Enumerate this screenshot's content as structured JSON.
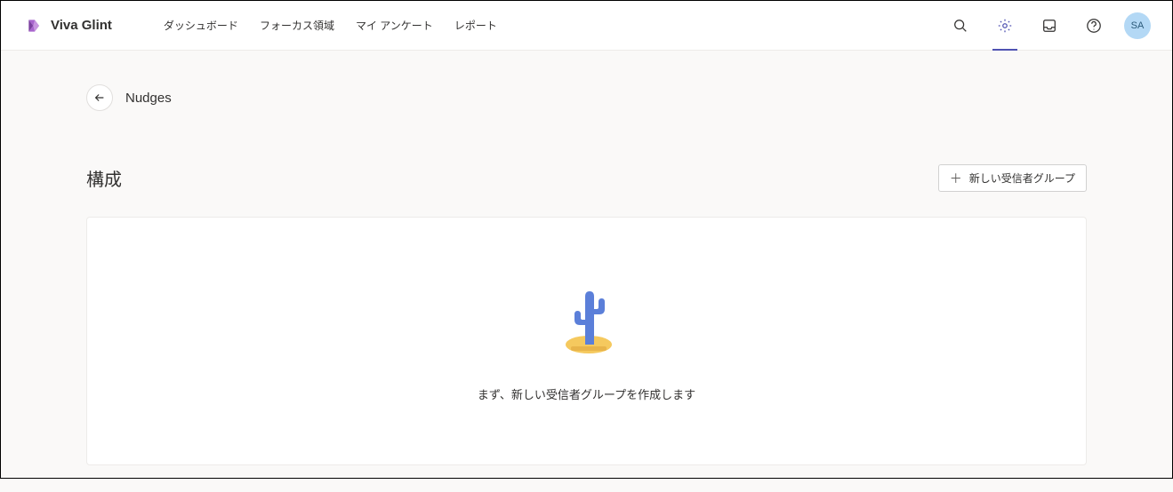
{
  "brand": {
    "name": "Viva Glint"
  },
  "nav": {
    "links": [
      "ダッシュボード",
      "フォーカス領域",
      "マイ アンケート",
      "レポート"
    ]
  },
  "user": {
    "initials": "SA"
  },
  "breadcrumb": {
    "page_title": "Nudges"
  },
  "section": {
    "title": "構成",
    "new_group_label": "新しい受信者グループ"
  },
  "empty_state": {
    "message": "まず、新しい受信者グループを作成します"
  }
}
